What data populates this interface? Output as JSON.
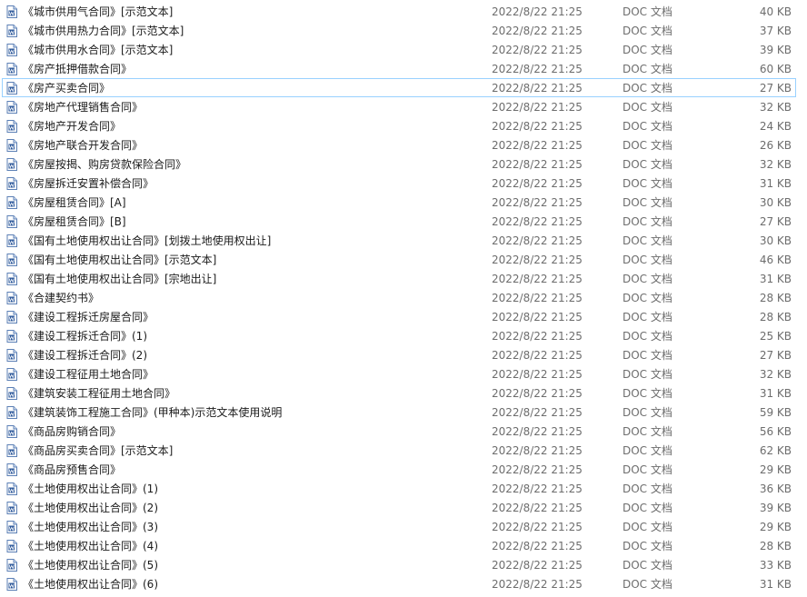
{
  "files": [
    {
      "name": "《城市供用气合同》[示范文本]",
      "date": "2022/8/22 21:25",
      "type": "DOC 文档",
      "size": "40 KB"
    },
    {
      "name": "《城市供用热力合同》[示范文本]",
      "date": "2022/8/22 21:25",
      "type": "DOC 文档",
      "size": "37 KB"
    },
    {
      "name": "《城市供用水合同》[示范文本]",
      "date": "2022/8/22 21:25",
      "type": "DOC 文档",
      "size": "39 KB"
    },
    {
      "name": "《房产抵押借款合同》",
      "date": "2022/8/22 21:25",
      "type": "DOC 文档",
      "size": "60 KB"
    },
    {
      "name": "《房产买卖合同》",
      "date": "2022/8/22 21:25",
      "type": "DOC 文档",
      "size": "27 KB",
      "focused": true
    },
    {
      "name": "《房地产代理销售合同》",
      "date": "2022/8/22 21:25",
      "type": "DOC 文档",
      "size": "32 KB"
    },
    {
      "name": "《房地产开发合同》",
      "date": "2022/8/22 21:25",
      "type": "DOC 文档",
      "size": "24 KB"
    },
    {
      "name": "《房地产联合开发合同》",
      "date": "2022/8/22 21:25",
      "type": "DOC 文档",
      "size": "26 KB"
    },
    {
      "name": "《房屋按揭、购房贷款保险合同》",
      "date": "2022/8/22 21:25",
      "type": "DOC 文档",
      "size": "32 KB"
    },
    {
      "name": "《房屋拆迁安置补偿合同》",
      "date": "2022/8/22 21:25",
      "type": "DOC 文档",
      "size": "31 KB"
    },
    {
      "name": "《房屋租赁合同》[A]",
      "date": "2022/8/22 21:25",
      "type": "DOC 文档",
      "size": "30 KB"
    },
    {
      "name": "《房屋租赁合同》[B]",
      "date": "2022/8/22 21:25",
      "type": "DOC 文档",
      "size": "27 KB"
    },
    {
      "name": "《国有土地使用权出让合同》[划拨土地使用权出让]",
      "date": "2022/8/22 21:25",
      "type": "DOC 文档",
      "size": "30 KB"
    },
    {
      "name": "《国有土地使用权出让合同》[示范文本]",
      "date": "2022/8/22 21:25",
      "type": "DOC 文档",
      "size": "46 KB"
    },
    {
      "name": "《国有土地使用权出让合同》[宗地出让]",
      "date": "2022/8/22 21:25",
      "type": "DOC 文档",
      "size": "31 KB"
    },
    {
      "name": "《合建契约书》",
      "date": "2022/8/22 21:25",
      "type": "DOC 文档",
      "size": "28 KB"
    },
    {
      "name": "《建设工程拆迁房屋合同》",
      "date": "2022/8/22 21:25",
      "type": "DOC 文档",
      "size": "28 KB"
    },
    {
      "name": "《建设工程拆迁合同》(1)",
      "date": "2022/8/22 21:25",
      "type": "DOC 文档",
      "size": "25 KB"
    },
    {
      "name": "《建设工程拆迁合同》(2)",
      "date": "2022/8/22 21:25",
      "type": "DOC 文档",
      "size": "27 KB"
    },
    {
      "name": "《建设工程征用土地合同》",
      "date": "2022/8/22 21:25",
      "type": "DOC 文档",
      "size": "32 KB"
    },
    {
      "name": "《建筑安装工程征用土地合同》",
      "date": "2022/8/22 21:25",
      "type": "DOC 文档",
      "size": "31 KB"
    },
    {
      "name": "《建筑装饰工程施工合同》(甲种本)示范文本使用说明",
      "date": "2022/8/22 21:25",
      "type": "DOC 文档",
      "size": "59 KB"
    },
    {
      "name": "《商品房购销合同》",
      "date": "2022/8/22 21:25",
      "type": "DOC 文档",
      "size": "56 KB"
    },
    {
      "name": "《商品房买卖合同》[示范文本]",
      "date": "2022/8/22 21:25",
      "type": "DOC 文档",
      "size": "62 KB"
    },
    {
      "name": "《商品房预售合同》",
      "date": "2022/8/22 21:25",
      "type": "DOC 文档",
      "size": "29 KB"
    },
    {
      "name": "《土地使用权出让合同》(1)",
      "date": "2022/8/22 21:25",
      "type": "DOC 文档",
      "size": "36 KB"
    },
    {
      "name": "《土地使用权出让合同》(2)",
      "date": "2022/8/22 21:25",
      "type": "DOC 文档",
      "size": "39 KB"
    },
    {
      "name": "《土地使用权出让合同》(3)",
      "date": "2022/8/22 21:25",
      "type": "DOC 文档",
      "size": "29 KB"
    },
    {
      "name": "《土地使用权出让合同》(4)",
      "date": "2022/8/22 21:25",
      "type": "DOC 文档",
      "size": "28 KB"
    },
    {
      "name": "《土地使用权出让合同》(5)",
      "date": "2022/8/22 21:25",
      "type": "DOC 文档",
      "size": "33 KB"
    },
    {
      "name": "《土地使用权出让合同》(6)",
      "date": "2022/8/22 21:25",
      "type": "DOC 文档",
      "size": "31 KB"
    }
  ],
  "icon": "word-document-icon",
  "colors": {
    "focus_border": "#99d1ff",
    "icon_blue": "#2b579a",
    "secondary_text": "#6d6d6d"
  }
}
